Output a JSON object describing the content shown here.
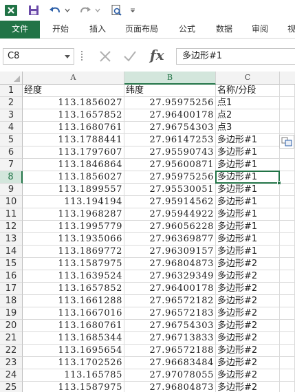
{
  "toolbar": {
    "save_icon": "save-icon",
    "undo_icon": "undo-icon",
    "redo_icon": "redo-icon",
    "preview_icon": "print-preview-icon",
    "customize_icon": "customize-icon"
  },
  "tabs": [
    "文件",
    "开始",
    "插入",
    "页面布局",
    "公式",
    "数据",
    "审阅",
    "视"
  ],
  "name_box": "C8",
  "formula_value": "多边形#1",
  "formula_fx": "fx",
  "columns": [
    "A",
    "B",
    "C"
  ],
  "rows": [
    {
      "n": "1",
      "a": "经度",
      "b": "纬度",
      "c": "名称/分段"
    },
    {
      "n": "2",
      "a": "113.1856027",
      "b": "27.95975256",
      "c": "点1"
    },
    {
      "n": "3",
      "a": "113.1657852",
      "b": "27.96400178",
      "c": "点2"
    },
    {
      "n": "4",
      "a": "113.1680761",
      "b": "27.96754303",
      "c": "点3"
    },
    {
      "n": "5",
      "a": "113.1788441",
      "b": "27.96147253",
      "c": "多边形#1"
    },
    {
      "n": "6",
      "a": "113.1797607",
      "b": "27.95590743",
      "c": "多边形#1"
    },
    {
      "n": "7",
      "a": "113.1846864",
      "b": "27.95600871",
      "c": "多边形#1"
    },
    {
      "n": "8",
      "a": "113.1856027",
      "b": "27.95975256",
      "c": "多边形#1"
    },
    {
      "n": "9",
      "a": "113.1899557",
      "b": "27.95530051",
      "c": "多边形#1"
    },
    {
      "n": "10",
      "a": "113.194194",
      "b": "27.95914562",
      "c": "多边形#1"
    },
    {
      "n": "11",
      "a": "113.1968287",
      "b": "27.95944922",
      "c": "多边形#1"
    },
    {
      "n": "12",
      "a": "113.1995779",
      "b": "27.96056228",
      "c": "多边形#1"
    },
    {
      "n": "13",
      "a": "113.1935066",
      "b": "27.96369877",
      "c": "多边形#1"
    },
    {
      "n": "14",
      "a": "113.1869772",
      "b": "27.96309157",
      "c": "多边形#1"
    },
    {
      "n": "15",
      "a": "113.1587975",
      "b": "27.96804873",
      "c": "多边形#2"
    },
    {
      "n": "16",
      "a": "113.1639524",
      "b": "27.96329349",
      "c": "多边形#2"
    },
    {
      "n": "17",
      "a": "113.1657852",
      "b": "27.96400178",
      "c": "多边形#2"
    },
    {
      "n": "18",
      "a": "113.1661288",
      "b": "27.96572182",
      "c": "多边形#2"
    },
    {
      "n": "19",
      "a": "113.1667016",
      "b": "27.96572183",
      "c": "多边形#2"
    },
    {
      "n": "20",
      "a": "113.1680761",
      "b": "27.96754303",
      "c": "多边形#2"
    },
    {
      "n": "21",
      "a": "113.1685344",
      "b": "27.96713833",
      "c": "多边形#2"
    },
    {
      "n": "22",
      "a": "113.1695654",
      "b": "27.96572188",
      "c": "多边形#2"
    },
    {
      "n": "23",
      "a": "113.1702526",
      "b": "27.96683484",
      "c": "多边形#2"
    },
    {
      "n": "24",
      "a": "113.165785",
      "b": "27.97078055",
      "c": "多边形#2"
    },
    {
      "n": "25",
      "a": "113.1587975",
      "b": "27.96804873",
      "c": "多边形#2"
    }
  ],
  "accent": "#217346"
}
